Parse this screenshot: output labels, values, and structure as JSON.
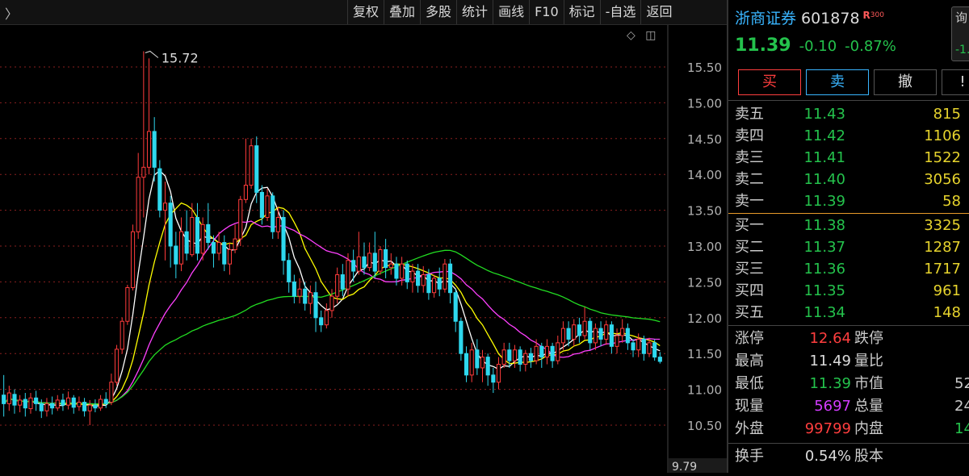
{
  "topbar": {
    "nav_glyph": "〉",
    "toolbar": [
      "复权",
      "叠加",
      "多股",
      "统计",
      "画线",
      "F10",
      "标记",
      "-自选",
      "返回"
    ]
  },
  "chart": {
    "tools": {
      "diamond_icon": "◇",
      "panel_icon": "◫"
    }
  },
  "chart_data": {
    "type": "candlestick",
    "ylim": [
      9.79,
      15.9
    ],
    "y_ticks": [
      "15.50",
      "15.00",
      "14.50",
      "14.00",
      "13.50",
      "13.00",
      "12.50",
      "12.00",
      "11.50",
      "11.00",
      "10.50"
    ],
    "y_floor_label": "9.79",
    "annotation": "15.72",
    "colors": {
      "up": "#ff3b3b",
      "down": "#2ed8ee",
      "ma_white": "#ffffff",
      "ma_yellow": "#ffff00",
      "ma_magenta": "#ff40ff",
      "ma_green": "#22dd22"
    },
    "candles": [
      [
        10.92,
        10.8,
        11.2,
        10.62
      ],
      [
        10.8,
        10.95,
        11.05,
        10.7
      ],
      [
        10.93,
        10.78,
        11.0,
        10.66
      ],
      [
        10.78,
        10.85,
        10.92,
        10.68
      ],
      [
        10.86,
        10.74,
        10.95,
        10.62
      ],
      [
        10.73,
        10.88,
        10.95,
        10.66
      ],
      [
        10.88,
        10.8,
        10.98,
        10.7
      ],
      [
        10.8,
        10.7,
        10.86,
        10.6
      ],
      [
        10.7,
        10.8,
        10.88,
        10.62
      ],
      [
        10.8,
        10.74,
        10.9,
        10.65
      ],
      [
        10.74,
        10.85,
        10.92,
        10.7
      ],
      [
        10.85,
        10.78,
        10.94,
        10.7
      ],
      [
        10.78,
        10.88,
        10.97,
        10.72
      ],
      [
        10.88,
        10.75,
        10.92,
        10.66
      ],
      [
        10.76,
        10.82,
        10.9,
        10.7
      ],
      [
        10.82,
        10.7,
        10.88,
        10.62
      ],
      [
        10.7,
        10.78,
        10.85,
        10.5
      ],
      [
        10.78,
        10.74,
        10.86,
        10.68
      ],
      [
        10.74,
        10.86,
        10.92,
        10.7
      ],
      [
        10.86,
        10.8,
        10.96,
        10.74
      ],
      [
        10.82,
        11.1,
        11.22,
        10.78
      ],
      [
        11.1,
        11.56,
        11.62,
        11.05
      ],
      [
        11.56,
        11.95,
        12.0,
        11.5
      ],
      [
        11.95,
        12.42,
        12.46,
        11.9
      ],
      [
        12.42,
        13.2,
        13.3,
        12.38
      ],
      [
        13.2,
        13.96,
        14.3,
        13.1
      ],
      [
        13.96,
        14.1,
        15.72,
        13.4
      ],
      [
        14.1,
        14.6,
        15.62,
        14.0
      ],
      [
        14.6,
        14.1,
        14.8,
        13.9
      ],
      [
        14.08,
        13.5,
        14.2,
        13.4
      ],
      [
        13.5,
        13.6,
        13.9,
        12.8
      ],
      [
        13.6,
        13.0,
        13.7,
        12.7
      ],
      [
        13.0,
        12.75,
        13.2,
        12.55
      ],
      [
        12.75,
        13.2,
        13.4,
        12.65
      ],
      [
        13.2,
        12.9,
        13.5,
        12.8
      ],
      [
        12.88,
        13.4,
        13.6,
        12.85
      ],
      [
        13.4,
        12.9,
        13.6,
        12.8
      ],
      [
        12.9,
        13.3,
        13.4,
        12.8
      ],
      [
        13.3,
        13.05,
        13.6,
        12.95
      ],
      [
        13.05,
        12.9,
        13.15,
        12.7
      ],
      [
        12.9,
        13.05,
        13.2,
        12.8
      ],
      [
        13.05,
        12.75,
        13.15,
        12.65
      ],
      [
        12.75,
        12.95,
        13.05,
        12.6
      ],
      [
        12.95,
        13.1,
        13.3,
        12.9
      ],
      [
        13.1,
        13.65,
        13.7,
        13.0
      ],
      [
        13.65,
        13.85,
        14.5,
        13.6
      ],
      [
        13.85,
        14.4,
        14.5,
        13.8
      ],
      [
        14.4,
        13.75,
        14.53,
        13.6
      ],
      [
        13.75,
        13.4,
        13.85,
        13.3
      ],
      [
        13.4,
        13.7,
        13.8,
        13.35
      ],
      [
        13.7,
        13.2,
        13.75,
        13.1
      ],
      [
        13.2,
        13.4,
        13.55,
        13.1
      ],
      [
        13.4,
        12.8,
        13.5,
        12.6
      ],
      [
        12.8,
        12.5,
        12.9,
        12.35
      ],
      [
        12.5,
        12.3,
        12.6,
        12.2
      ],
      [
        12.3,
        12.4,
        12.55,
        12.2
      ],
      [
        12.4,
        12.2,
        12.5,
        12.1
      ],
      [
        12.2,
        12.35,
        12.45,
        12.05
      ],
      [
        12.35,
        12.0,
        12.5,
        11.8
      ],
      [
        12.0,
        11.9,
        12.1,
        11.8
      ],
      [
        11.9,
        12.1,
        12.2,
        11.85
      ],
      [
        12.1,
        12.3,
        12.4,
        12.0
      ],
      [
        12.3,
        12.6,
        12.7,
        12.2
      ],
      [
        12.6,
        12.4,
        12.75,
        12.3
      ],
      [
        12.4,
        12.8,
        12.9,
        12.3
      ],
      [
        12.8,
        12.65,
        12.95,
        12.5
      ],
      [
        12.65,
        12.85,
        13.2,
        12.6
      ],
      [
        12.85,
        12.7,
        13.05,
        12.6
      ],
      [
        12.7,
        12.9,
        13.05,
        12.65
      ],
      [
        12.9,
        12.65,
        13.2,
        12.55
      ],
      [
        12.65,
        12.95,
        13.0,
        12.6
      ],
      [
        12.95,
        12.7,
        13.1,
        12.55
      ],
      [
        12.7,
        12.75,
        12.9,
        12.6
      ],
      [
        12.75,
        12.55,
        12.85,
        12.45
      ],
      [
        12.55,
        12.75,
        12.85,
        12.45
      ],
      [
        12.75,
        12.5,
        12.8,
        12.4
      ],
      [
        12.5,
        12.65,
        12.75,
        12.35
      ],
      [
        12.65,
        12.45,
        12.75,
        12.35
      ],
      [
        12.45,
        12.6,
        12.72,
        12.35
      ],
      [
        12.6,
        12.35,
        12.68,
        12.25
      ],
      [
        12.35,
        12.55,
        12.6,
        12.28
      ],
      [
        12.55,
        12.4,
        12.7,
        12.3
      ],
      [
        12.4,
        12.75,
        12.82,
        12.35
      ],
      [
        12.75,
        12.35,
        12.82,
        12.2
      ],
      [
        12.35,
        11.95,
        12.4,
        11.8
      ],
      [
        11.95,
        11.5,
        12.0,
        11.4
      ],
      [
        11.5,
        11.2,
        11.6,
        11.1
      ],
      [
        11.2,
        11.55,
        11.65,
        11.1
      ],
      [
        11.55,
        11.3,
        11.7,
        11.2
      ],
      [
        11.3,
        11.45,
        11.55,
        11.1
      ],
      [
        11.45,
        11.2,
        11.5,
        11.05
      ],
      [
        11.2,
        11.1,
        11.3,
        10.95
      ],
      [
        11.1,
        11.35,
        11.45,
        11.0
      ],
      [
        11.35,
        11.55,
        11.65,
        11.3
      ],
      [
        11.55,
        11.4,
        11.65,
        11.3
      ],
      [
        11.4,
        11.55,
        11.62,
        11.3
      ],
      [
        11.55,
        11.35,
        11.6,
        11.25
      ],
      [
        11.35,
        11.5,
        11.55,
        11.25
      ],
      [
        11.5,
        11.4,
        11.58,
        11.3
      ],
      [
        11.4,
        11.6,
        11.7,
        11.35
      ],
      [
        11.6,
        11.45,
        11.65,
        11.3
      ],
      [
        11.45,
        11.6,
        11.7,
        11.35
      ],
      [
        11.6,
        11.4,
        11.65,
        11.3
      ],
      [
        11.4,
        11.65,
        11.75,
        11.35
      ],
      [
        11.65,
        11.85,
        11.95,
        11.55
      ],
      [
        11.85,
        11.7,
        11.95,
        11.6
      ],
      [
        11.7,
        11.9,
        11.98,
        11.6
      ],
      [
        11.9,
        11.75,
        12.0,
        11.65
      ],
      [
        11.75,
        11.95,
        12.15,
        11.7
      ],
      [
        11.95,
        11.65,
        12.0,
        11.55
      ],
      [
        11.65,
        11.85,
        11.92,
        11.55
      ],
      [
        11.85,
        11.7,
        11.95,
        11.6
      ],
      [
        11.7,
        11.9,
        11.96,
        11.62
      ],
      [
        11.9,
        11.6,
        11.95,
        11.5
      ],
      [
        11.6,
        11.75,
        11.85,
        11.5
      ],
      [
        11.75,
        11.85,
        11.98,
        11.65
      ],
      [
        11.85,
        11.65,
        11.92,
        11.55
      ],
      [
        11.65,
        11.55,
        11.7,
        11.45
      ],
      [
        11.55,
        11.7,
        11.78,
        11.45
      ],
      [
        11.7,
        11.5,
        11.75,
        11.4
      ],
      [
        11.5,
        11.65,
        11.72,
        11.45
      ],
      [
        11.65,
        11.45,
        11.7,
        11.4
      ],
      [
        11.45,
        11.39,
        11.52,
        11.36
      ]
    ]
  },
  "panel": {
    "stock_name": "浙商证券",
    "stock_code": "601878",
    "badge_r": "R",
    "badge_num": "300",
    "edge_top": "询",
    "edge_bottom": "-1.",
    "price": "11.39",
    "change": "-0.10",
    "change_pct": "-0.87%",
    "buttons": {
      "buy": "买",
      "sell": "卖",
      "cancel": "撤",
      "more": "!"
    },
    "asks": [
      {
        "label": "卖五",
        "price": "11.43",
        "vol": "815"
      },
      {
        "label": "卖四",
        "price": "11.42",
        "vol": "1106"
      },
      {
        "label": "卖三",
        "price": "11.41",
        "vol": "1522"
      },
      {
        "label": "卖二",
        "price": "11.40",
        "vol": "3056"
      },
      {
        "label": "卖一",
        "price": "11.39",
        "vol": "58"
      }
    ],
    "bids": [
      {
        "label": "买一",
        "price": "11.38",
        "vol": "3325"
      },
      {
        "label": "买二",
        "price": "11.37",
        "vol": "1287"
      },
      {
        "label": "买三",
        "price": "11.36",
        "vol": "1717"
      },
      {
        "label": "买四",
        "price": "11.35",
        "vol": "961"
      },
      {
        "label": "买五",
        "price": "11.34",
        "vol": "148"
      }
    ],
    "stats": [
      {
        "l1": "涨停",
        "v1": "12.64",
        "c1": "red",
        "l2": "跌停",
        "v2": ""
      },
      {
        "l1": "最高",
        "v1": "11.49",
        "c1": "white",
        "l2": "量比",
        "v2": ""
      },
      {
        "l1": "最低",
        "v1": "11.39",
        "c1": "green",
        "l2": "市值",
        "v2": "52"
      },
      {
        "l1": "现量",
        "v1": "5697",
        "c1": "purple",
        "l2": "总量",
        "v2": "24"
      },
      {
        "l1": "外盘",
        "v1": "99799",
        "c1": "red",
        "l2": "内盘",
        "v2": "14"
      },
      {
        "l1": "换手",
        "v1": "0.54%",
        "c1": "white",
        "l2": "股本",
        "v2": ""
      }
    ]
  }
}
